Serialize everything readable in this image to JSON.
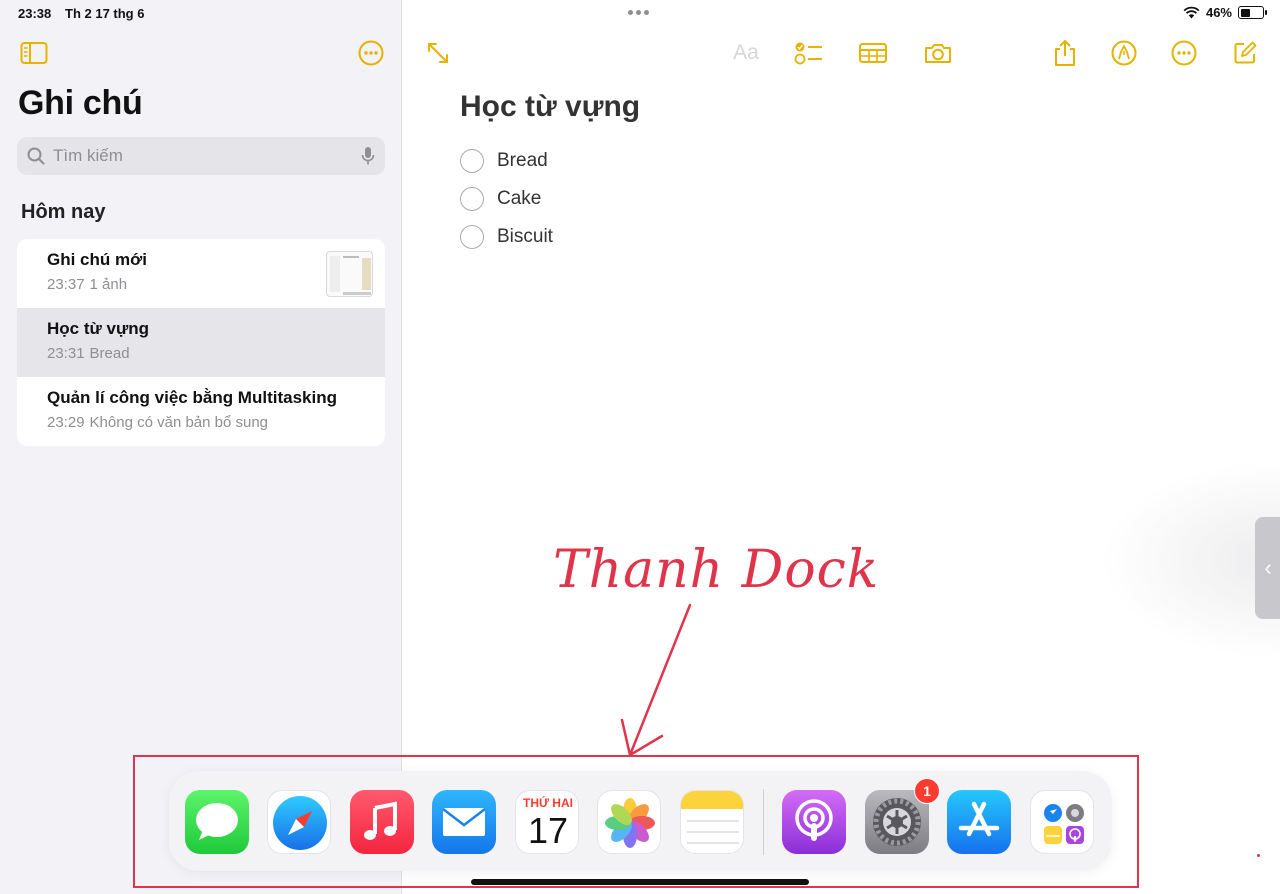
{
  "status_bar": {
    "time": "23:38",
    "date": "Th 2 17 thg 6",
    "battery": "46%",
    "battery_level": 0.46
  },
  "sidebar": {
    "title": "Ghi chú",
    "search_placeholder": "Tìm kiếm",
    "section": "Hôm nay",
    "notes": [
      {
        "title": "Ghi chú mới",
        "time": "23:37",
        "preview": "1 ảnh"
      },
      {
        "title": "Học từ vựng",
        "time": "23:31",
        "preview": "Bread"
      },
      {
        "title": "Quản lí công việc bằng Multitasking",
        "time": "23:29",
        "preview": "Không có văn bản bổ sung"
      }
    ]
  },
  "toolbar": {
    "format_label": "Aa"
  },
  "note": {
    "title": "Học từ vựng",
    "checklist": [
      "Bread",
      "Cake",
      "Biscuit"
    ]
  },
  "annotation": {
    "text": "Thanh Dock"
  },
  "dock": {
    "apps": [
      "messages-app",
      "safari-app",
      "music-app",
      "mail-app",
      "calendar-app",
      "photos-app",
      "notes-app",
      "podcasts-app",
      "settings-app",
      "app-store-app",
      "app-library-folder"
    ],
    "calendar_day": "THỨ HAI",
    "calendar_date": "17",
    "settings_badge": "1"
  },
  "colors": {
    "accent": "#e5b300",
    "annotation": "#e0344a",
    "badge": "#ff3b30"
  }
}
